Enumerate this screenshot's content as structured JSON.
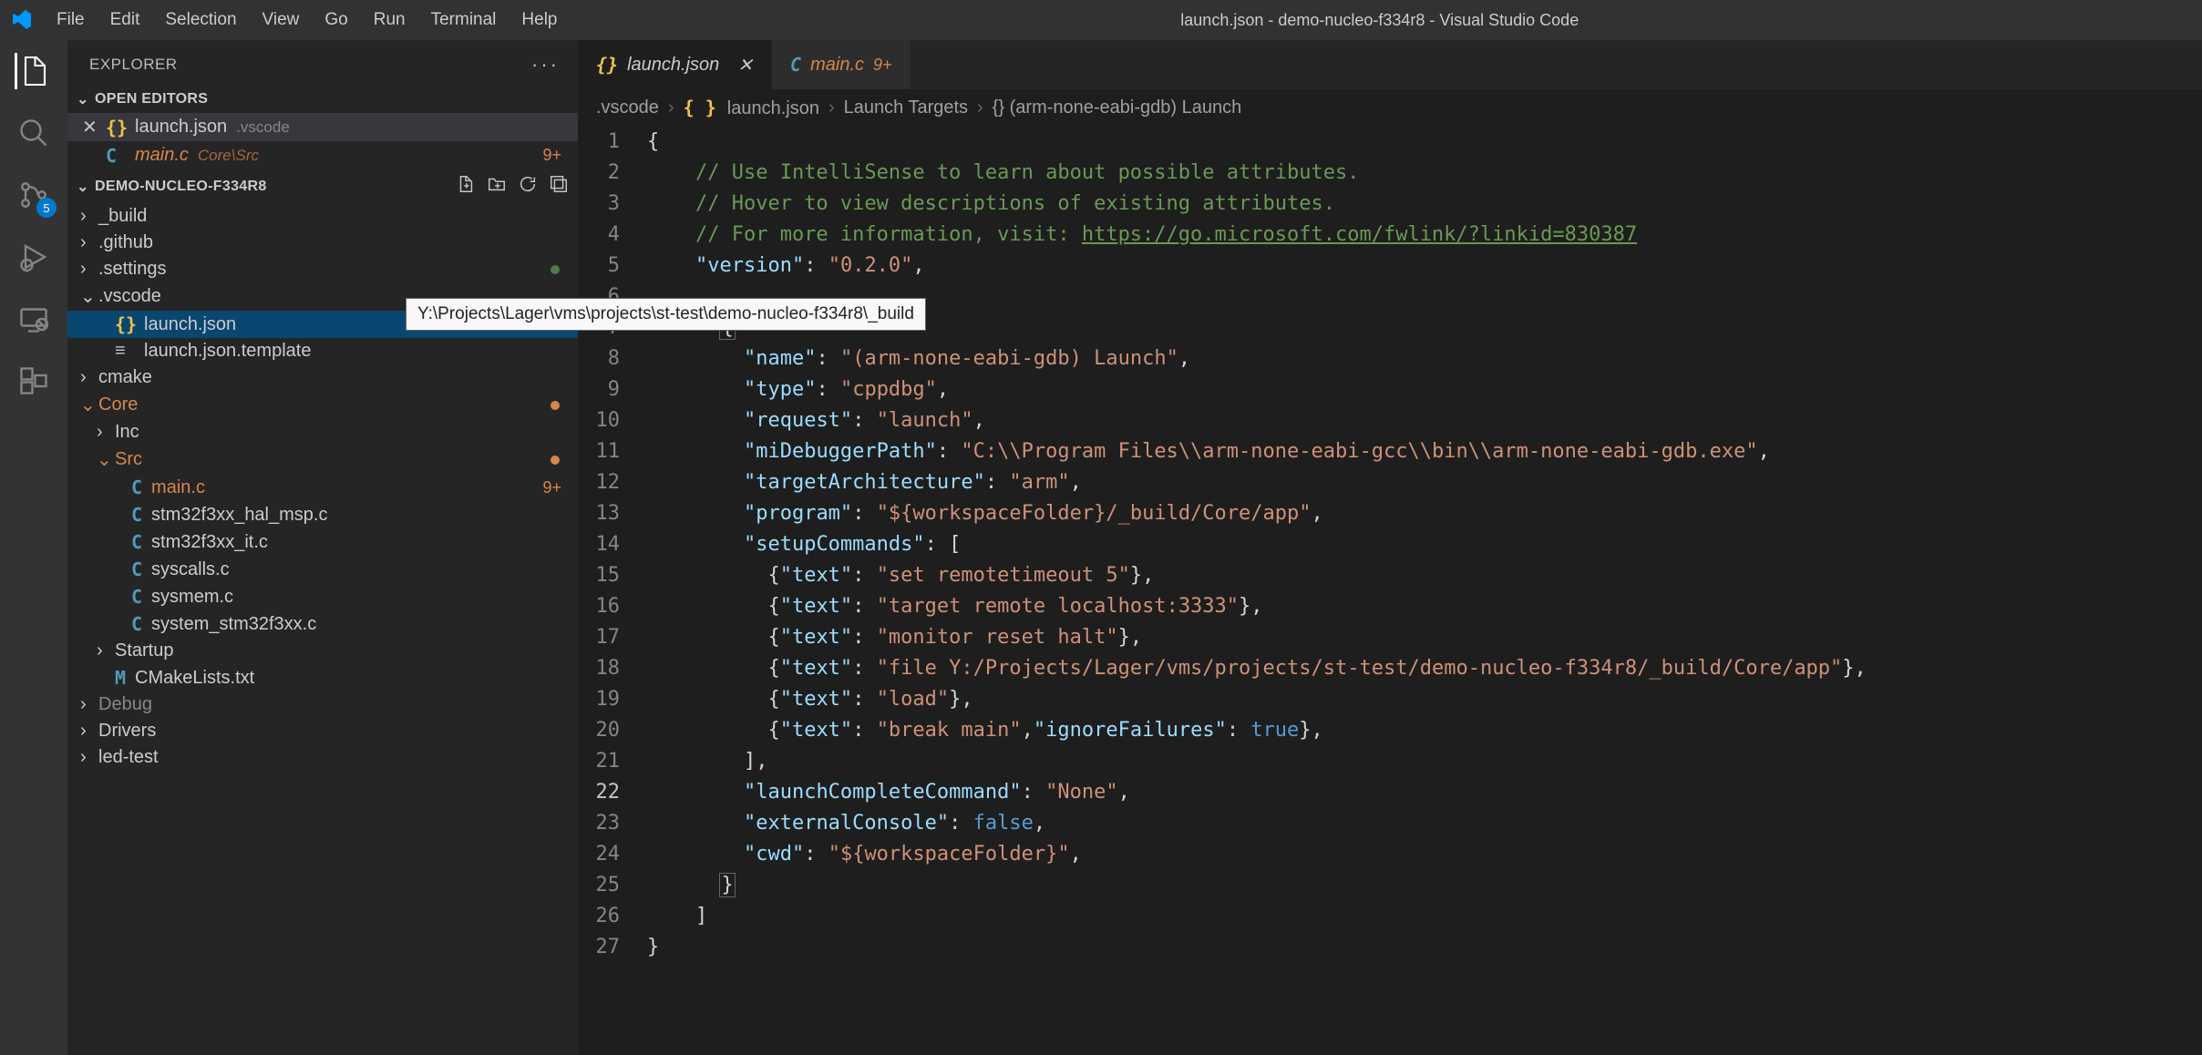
{
  "window_title": "launch.json - demo-nucleo-f334r8 - Visual Studio Code",
  "menu": [
    "File",
    "Edit",
    "Selection",
    "View",
    "Go",
    "Run",
    "Terminal",
    "Help"
  ],
  "sidebar": {
    "title": "EXPLORER",
    "open_editors_label": "OPEN EDITORS",
    "open_editors": [
      {
        "icon": "json",
        "name": "launch.json",
        "path": ".vscode",
        "modified": false,
        "badge": ""
      },
      {
        "icon": "c",
        "name": "main.c",
        "path": "Core\\Src",
        "modified": true,
        "badge": "9+"
      }
    ],
    "project_name": "DEMO-NUCLEO-F334R8",
    "tree": [
      {
        "indent": 0,
        "chev": ">",
        "label": "_build",
        "icon": ""
      },
      {
        "indent": 0,
        "chev": ">",
        "label": ".github",
        "icon": ""
      },
      {
        "indent": 0,
        "chev": ">",
        "label": ".settings",
        "icon": "",
        "green": true
      },
      {
        "indent": 0,
        "chev": "v",
        "label": ".vscode",
        "icon": ""
      },
      {
        "indent": 1,
        "chev": "",
        "label": "launch.json",
        "icon": "json",
        "selected": true
      },
      {
        "indent": 1,
        "chev": "",
        "label": "launch.json.template",
        "icon": "lines"
      },
      {
        "indent": 0,
        "chev": ">",
        "label": "cmake",
        "icon": ""
      },
      {
        "indent": 0,
        "chev": "v",
        "label": "Core",
        "icon": "",
        "modified": true,
        "dot": true
      },
      {
        "indent": 1,
        "chev": ">",
        "label": "Inc",
        "icon": ""
      },
      {
        "indent": 1,
        "chev": "v",
        "label": "Src",
        "icon": "",
        "modified": true,
        "dot": true
      },
      {
        "indent": 2,
        "chev": "",
        "label": "main.c",
        "icon": "c",
        "modified": true,
        "badge": "9+"
      },
      {
        "indent": 2,
        "chev": "",
        "label": "stm32f3xx_hal_msp.c",
        "icon": "c"
      },
      {
        "indent": 2,
        "chev": "",
        "label": "stm32f3xx_it.c",
        "icon": "c"
      },
      {
        "indent": 2,
        "chev": "",
        "label": "syscalls.c",
        "icon": "c"
      },
      {
        "indent": 2,
        "chev": "",
        "label": "sysmem.c",
        "icon": "c"
      },
      {
        "indent": 2,
        "chev": "",
        "label": "system_stm32f3xx.c",
        "icon": "c"
      },
      {
        "indent": 1,
        "chev": ">",
        "label": "Startup",
        "icon": ""
      },
      {
        "indent": 1,
        "chev": "",
        "label": "CMakeLists.txt",
        "icon": "m"
      },
      {
        "indent": 0,
        "chev": ">",
        "label": "Debug",
        "icon": "",
        "faded": true
      },
      {
        "indent": 0,
        "chev": ">",
        "label": "Drivers",
        "icon": ""
      },
      {
        "indent": 0,
        "chev": ">",
        "label": "led-test",
        "icon": ""
      }
    ]
  },
  "activity_badge": "5",
  "tabs": [
    {
      "icon": "json",
      "label": "launch.json",
      "active": true,
      "close": true
    },
    {
      "icon": "c",
      "label": "main.c",
      "active": false,
      "modified": true,
      "badge": "9+"
    }
  ],
  "breadcrumbs": [
    ".vscode",
    "{} launch.json",
    "Launch Targets",
    "{} (arm-none-eabi-gdb) Launch"
  ],
  "tooltip": "Y:\\Projects\\Lager\\vms\\projects\\st-test\\demo-nucleo-f334r8\\_build",
  "code_url": "https://go.microsoft.com/fwlink/?linkid=830387",
  "code": {
    "version": "0.2.0",
    "cfg_name": "(arm-none-eabi-gdb) Launch",
    "cfg_type": "cppdbg",
    "cfg_request": "launch",
    "cfg_miDebuggerPath": "C:\\\\Program Files\\\\arm-none-eabi-gcc\\\\bin\\\\arm-none-eabi-gdb.exe",
    "cfg_targetArch": "arm",
    "cfg_program": "${workspaceFolder}/_build/Core/app",
    "setup1": "set remotetimeout 5",
    "setup2": "target remote localhost:3333",
    "setup3": "monitor reset halt",
    "setup4": "file Y:/Projects/Lager/vms/projects/st-test/demo-nucleo-f334r8/_build/Core/app",
    "setup5": "load",
    "setup6": "break main",
    "launchComplete": "None",
    "externalConsole": "false",
    "cwd": "${workspaceFolder}"
  }
}
